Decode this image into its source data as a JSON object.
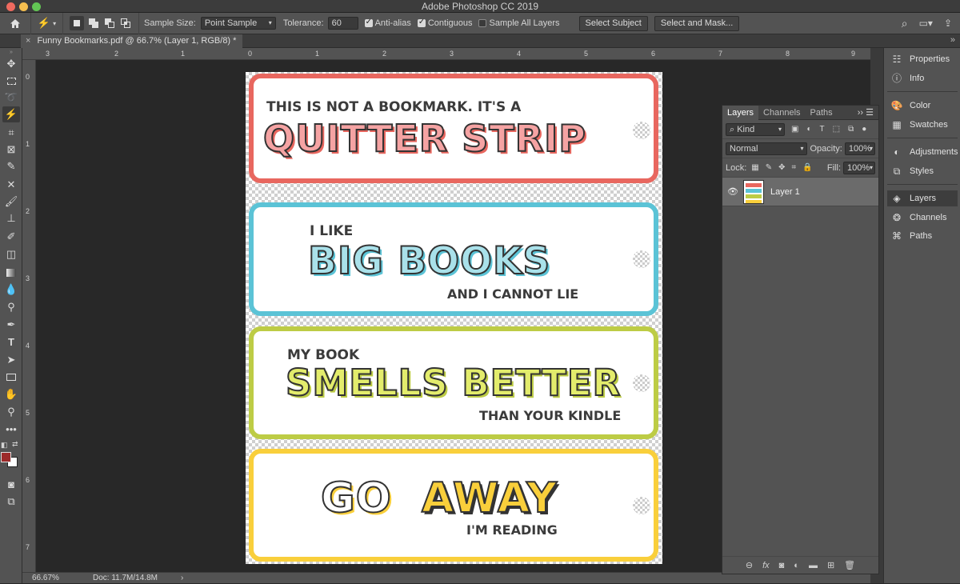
{
  "app": {
    "title": "Adobe Photoshop CC 2019"
  },
  "options": {
    "sample_size_label": "Sample Size:",
    "sample_size_value": "Point Sample",
    "tolerance_label": "Tolerance:",
    "tolerance_value": "60",
    "anti_alias": "Anti-alias",
    "contiguous": "Contiguous",
    "sample_all": "Sample All Layers",
    "select_subject": "Select Subject",
    "select_mask": "Select and Mask..."
  },
  "document": {
    "tab_title": "Funny Bookmarks.pdf @ 66.7% (Layer 1, RGB/8) *",
    "card1_small": "THIS IS NOT A BOOKMARK. IT'S A",
    "card1_big": "QUITTER STRIP",
    "card2_small": "I LIKE",
    "card2_big": "BIG BOOKS",
    "card2_bottom": "AND I CANNOT LIE",
    "card3_small": "MY BOOK",
    "card3_big": "SMELLS BETTER",
    "card3_bottom": "THAN YOUR KINDLE",
    "card4_big_a": "GO",
    "card4_big_b": "AWAY",
    "card4_bottom": "I'M READING"
  },
  "colors": {
    "red": "#e8675f",
    "blue": "#5bc3d6",
    "green": "#bdcc45",
    "yellow": "#f9cf3b"
  },
  "rulers": {
    "h": [
      "3",
      "2",
      "1",
      "0",
      "1",
      "2",
      "3",
      "4",
      "5",
      "6",
      "7",
      "8",
      "9"
    ],
    "v": [
      "0",
      "1",
      "2",
      "3",
      "4",
      "5",
      "6",
      "7"
    ]
  },
  "status": {
    "zoom": "66.67%",
    "doc": "Doc: 11.7M/14.8M",
    "arrow": "›"
  },
  "layers": {
    "tabs": [
      "Layers",
      "Channels",
      "Paths"
    ],
    "kind": "Kind",
    "blend": "Normal",
    "opacity_label": "Opacity:",
    "opacity": "100%",
    "lock_label": "Lock:",
    "fill_label": "Fill:",
    "fill": "100%",
    "layer_name": "Layer 1",
    "fx": "fx"
  },
  "dock": {
    "properties": "Properties",
    "info": "Info",
    "color": "Color",
    "swatches": "Swatches",
    "adjustments": "Adjustments",
    "styles": "Styles",
    "layers": "Layers",
    "channels": "Channels",
    "paths": "Paths"
  }
}
